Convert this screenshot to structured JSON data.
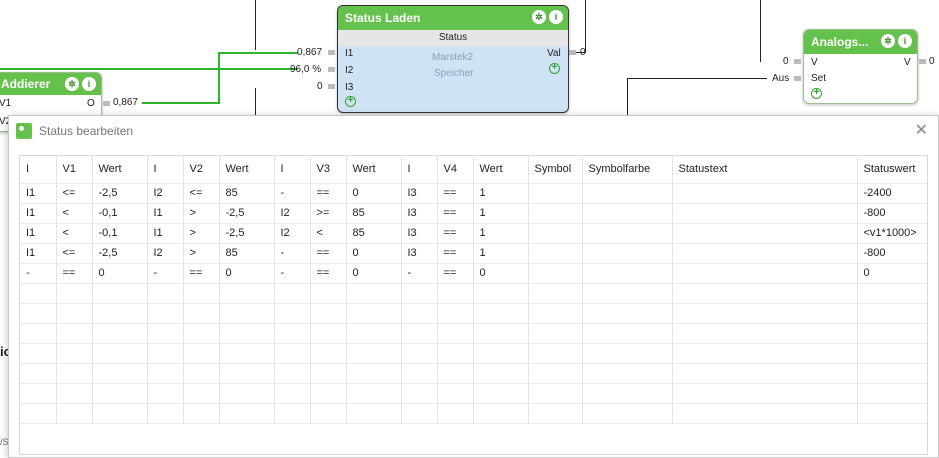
{
  "nodes": {
    "addierer": {
      "title": "Addierer",
      "out_label": "O",
      "out_value": "0,867",
      "in1": "V1",
      "in2": "V2"
    },
    "status_laden": {
      "title": "Status Laden",
      "sub_header": "Status",
      "desc1": "Marstek2",
      "desc2": "Speicher",
      "inputs": [
        "I1",
        "I2",
        "I3"
      ],
      "input_values": [
        "0,867",
        "96,0 %",
        "0"
      ],
      "output_label": "Val",
      "output_value": "0"
    },
    "analog": {
      "title": "Analogs...",
      "in_v": "V",
      "in_set": "Set",
      "out_v": "V",
      "in_v_value": "0",
      "in_set_value": "Aus",
      "out_value": "0"
    }
  },
  "dialog": {
    "title": "Status bearbeiten",
    "close_icon": "close-icon",
    "columns": [
      "I",
      "V1",
      "Wert",
      "I",
      "V2",
      "Wert",
      "I",
      "V3",
      "Wert",
      "I",
      "V4",
      "Wert",
      "Symbol",
      "Symbolfarbe",
      "Statustext",
      "Statuswert"
    ],
    "rows": [
      [
        "I1",
        "<=",
        "-2,5",
        "I2",
        "<=",
        "85",
        "-",
        "==",
        "0",
        "I3",
        "==",
        "1",
        "",
        "",
        "",
        "-2400"
      ],
      [
        "I1",
        "<",
        "-0,1",
        "I1",
        ">",
        "-2,5",
        "I2",
        ">=",
        "85",
        "I3",
        "==",
        "1",
        "",
        "",
        "",
        "-800"
      ],
      [
        "I1",
        "<",
        "-0,1",
        "I1",
        ">",
        "-2,5",
        "I2",
        "<",
        "85",
        "I3",
        "==",
        "1",
        "",
        "",
        "",
        "<v1*1000>"
      ],
      [
        "I1",
        "<=",
        "-2,5",
        "I2",
        ">",
        "85",
        "-",
        "==",
        "0",
        "I3",
        "==",
        "1",
        "",
        "",
        "",
        "-800"
      ],
      [
        "-",
        "==",
        "0",
        "-",
        "==",
        "0",
        "-",
        "==",
        "0",
        "-",
        "==",
        "0",
        "",
        "",
        "",
        "0"
      ]
    ],
    "empty_rows": 7
  },
  "colors": {
    "accent": "#64c24c",
    "wire_active": "#2db52d",
    "node_selected": "#cfe3f5"
  },
  "background_fragments": {
    "left_partial_text": "ic",
    "left_bottom_text": "/S"
  }
}
